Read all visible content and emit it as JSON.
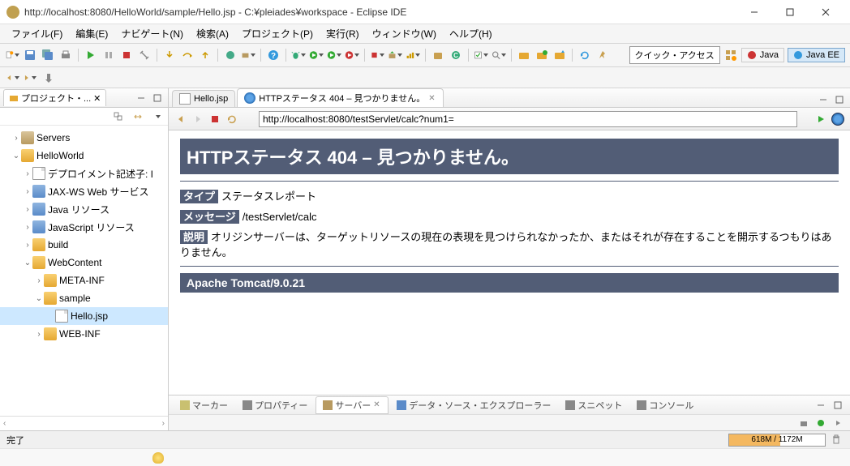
{
  "window": {
    "title": "http://localhost:8080/HelloWorld/sample/Hello.jsp - C:¥pleiades¥workspace - Eclipse IDE"
  },
  "menubar": {
    "items": [
      "ファイル(F)",
      "編集(E)",
      "ナビゲート(N)",
      "検索(A)",
      "プロジェクト(P)",
      "実行(R)",
      "ウィンドウ(W)",
      "ヘルプ(H)"
    ]
  },
  "quick_access": "クイック・アクセス",
  "perspectives": {
    "java": "Java",
    "javaee": "Java EE"
  },
  "project_explorer": {
    "title": "プロジェクト・...",
    "tree": {
      "servers": "Servers",
      "helloworld": "HelloWorld",
      "deploy_desc": "デプロイメント記述子: I",
      "jaxws": "JAX-WS Web サービス",
      "java_res": "Java リソース",
      "js_res": "JavaScript リソース",
      "build": "build",
      "webcontent": "WebContent",
      "metainf": "META-INF",
      "sample": "sample",
      "hellojsp": "Hello.jsp",
      "webinf": "WEB-INF"
    }
  },
  "editor_tabs": {
    "hello": "Hello.jsp",
    "error404": "HTTPステータス 404 – 見つかりません。"
  },
  "browser": {
    "url": "http://localhost:8080/testServlet/calc?num1="
  },
  "error_page": {
    "title": "HTTPステータス 404 – 見つかりません。",
    "type_label": "タイプ",
    "type_value": "ステータスレポート",
    "message_label": "メッセージ",
    "message_value": "/testServlet/calc",
    "desc_label": "説明",
    "desc_value": "オリジンサーバーは、ターゲットリソースの現在の表現を見つけられなかったか、またはそれが存在することを開示するつもりはありません。",
    "footer": "Apache Tomcat/9.0.21"
  },
  "bottom_tabs": {
    "marker": "マーカー",
    "property": "プロパティー",
    "server": "サーバー",
    "datasource": "データ・ソース・エクスプローラー",
    "snippet": "スニペット",
    "console": "コンソール"
  },
  "statusbar": {
    "done": "完了",
    "memory": "618M / 1172M"
  }
}
